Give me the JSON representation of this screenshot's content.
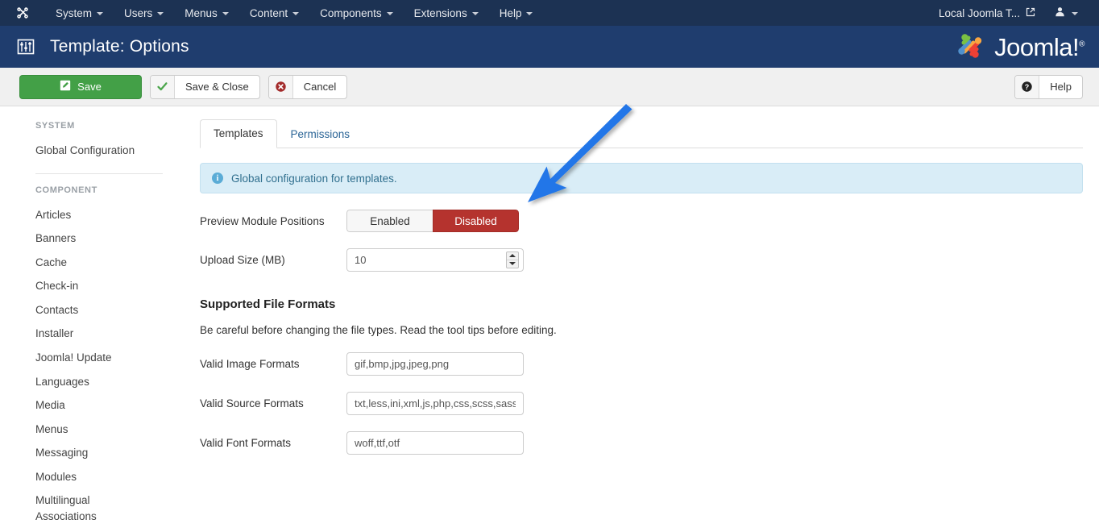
{
  "topbar": {
    "brand_icon": "joomla-brand-icon",
    "menu": [
      {
        "label": "System",
        "icon": "chevron-down-icon"
      },
      {
        "label": "Users",
        "icon": "chevron-down-icon"
      },
      {
        "label": "Menus",
        "icon": "chevron-down-icon"
      },
      {
        "label": "Content",
        "icon": "chevron-down-icon"
      },
      {
        "label": "Components",
        "icon": "chevron-down-icon"
      },
      {
        "label": "Extensions",
        "icon": "chevron-down-icon"
      },
      {
        "label": "Help",
        "icon": "chevron-down-icon"
      }
    ],
    "site_link_label": "Local Joomla T...",
    "site_link_icon": "external-link-icon",
    "user_icon": "user-icon",
    "user_caret_icon": "chevron-down-icon",
    "background": "#1c3253"
  },
  "header": {
    "icon": "sliders-options-icon",
    "title": "Template: Options",
    "logo_text": "Joomla!",
    "logo_mark": "joomla-logo-icon",
    "background": "#1f3d6e"
  },
  "toolbar": {
    "save_label": "Save",
    "save_icon": "pencil-square-icon",
    "save_close_label": "Save & Close",
    "save_close_icon": "check-icon",
    "cancel_label": "Cancel",
    "cancel_icon": "times-circle-icon",
    "help_label": "Help",
    "help_icon": "question-circle-icon",
    "save_color": "#43a047"
  },
  "sidebar": {
    "system_heading": "SYSTEM",
    "system_items": [
      {
        "label": "Global Configuration"
      }
    ],
    "component_heading": "COMPONENT",
    "component_items": [
      {
        "label": "Articles"
      },
      {
        "label": "Banners"
      },
      {
        "label": "Cache"
      },
      {
        "label": "Check-in"
      },
      {
        "label": "Contacts"
      },
      {
        "label": "Installer"
      },
      {
        "label": "Joomla! Update"
      },
      {
        "label": "Languages"
      },
      {
        "label": "Media"
      },
      {
        "label": "Menus"
      },
      {
        "label": "Messaging"
      },
      {
        "label": "Modules"
      },
      {
        "label": "Multilingual Associations"
      }
    ]
  },
  "main": {
    "tabs": [
      {
        "label": "Templates",
        "active": true
      },
      {
        "label": "Permissions",
        "active": false
      }
    ],
    "alert": {
      "icon": "info-circle-icon",
      "text": "Global configuration for templates.",
      "background": "#d9edf7",
      "color": "#31708f"
    },
    "preview_module_positions": {
      "label": "Preview Module Positions",
      "options": [
        "Enabled",
        "Disabled"
      ],
      "selected": "Disabled",
      "active_color": "#b5332e"
    },
    "upload_size": {
      "label": "Upload Size (MB)",
      "value": "10",
      "spinner_up_icon": "caret-up-icon",
      "spinner_down_icon": "caret-down-icon"
    },
    "formats_section": {
      "title": "Supported File Formats",
      "description": "Be careful before changing the file types. Read the tool tips before editing."
    },
    "fields": [
      {
        "label": "Valid Image Formats",
        "value": "gif,bmp,jpg,jpeg,png"
      },
      {
        "label": "Valid Source Formats",
        "value": "txt,less,ini,xml,js,php,css,scss,sass,sh,twig,yaml,yml"
      },
      {
        "label": "Valid Font Formats",
        "value": "woff,ttf,otf"
      }
    ]
  },
  "annotation": {
    "arrow_icon": "blue-arrow-annotation",
    "color": "#2176e8"
  }
}
